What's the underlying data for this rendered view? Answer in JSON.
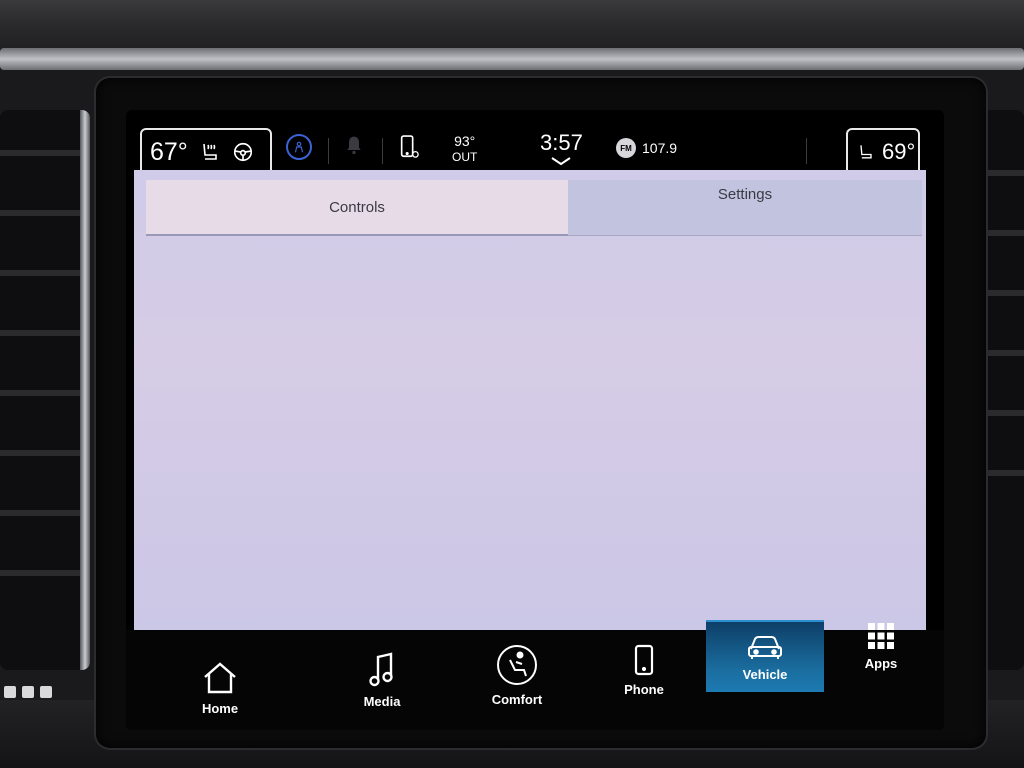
{
  "status_bar": {
    "driver_temp": "67°",
    "passenger_temp": "69°",
    "outside_temp": "93°",
    "outside_label": "OUT",
    "clock": "3:57",
    "radio_band": "FM",
    "radio_freq": "107.9"
  },
  "tabs": [
    {
      "label": "Controls",
      "active": true
    },
    {
      "label": "Settings",
      "active": false
    }
  ],
  "nav": [
    {
      "label": "Home",
      "icon": "home-icon"
    },
    {
      "label": "Media",
      "icon": "music-note-icon"
    },
    {
      "label": "Comfort",
      "icon": "climate-seat-icon"
    },
    {
      "label": "Phone",
      "icon": "phone-icon"
    },
    {
      "label": "Vehicle",
      "icon": "car-icon",
      "active": true
    },
    {
      "label": "Apps",
      "icon": "apps-grid-icon"
    }
  ],
  "colors": {
    "active_nav": "#1a6ea0",
    "content_bg": "#cfcbe8",
    "accent_blue": "#3b63d6"
  }
}
